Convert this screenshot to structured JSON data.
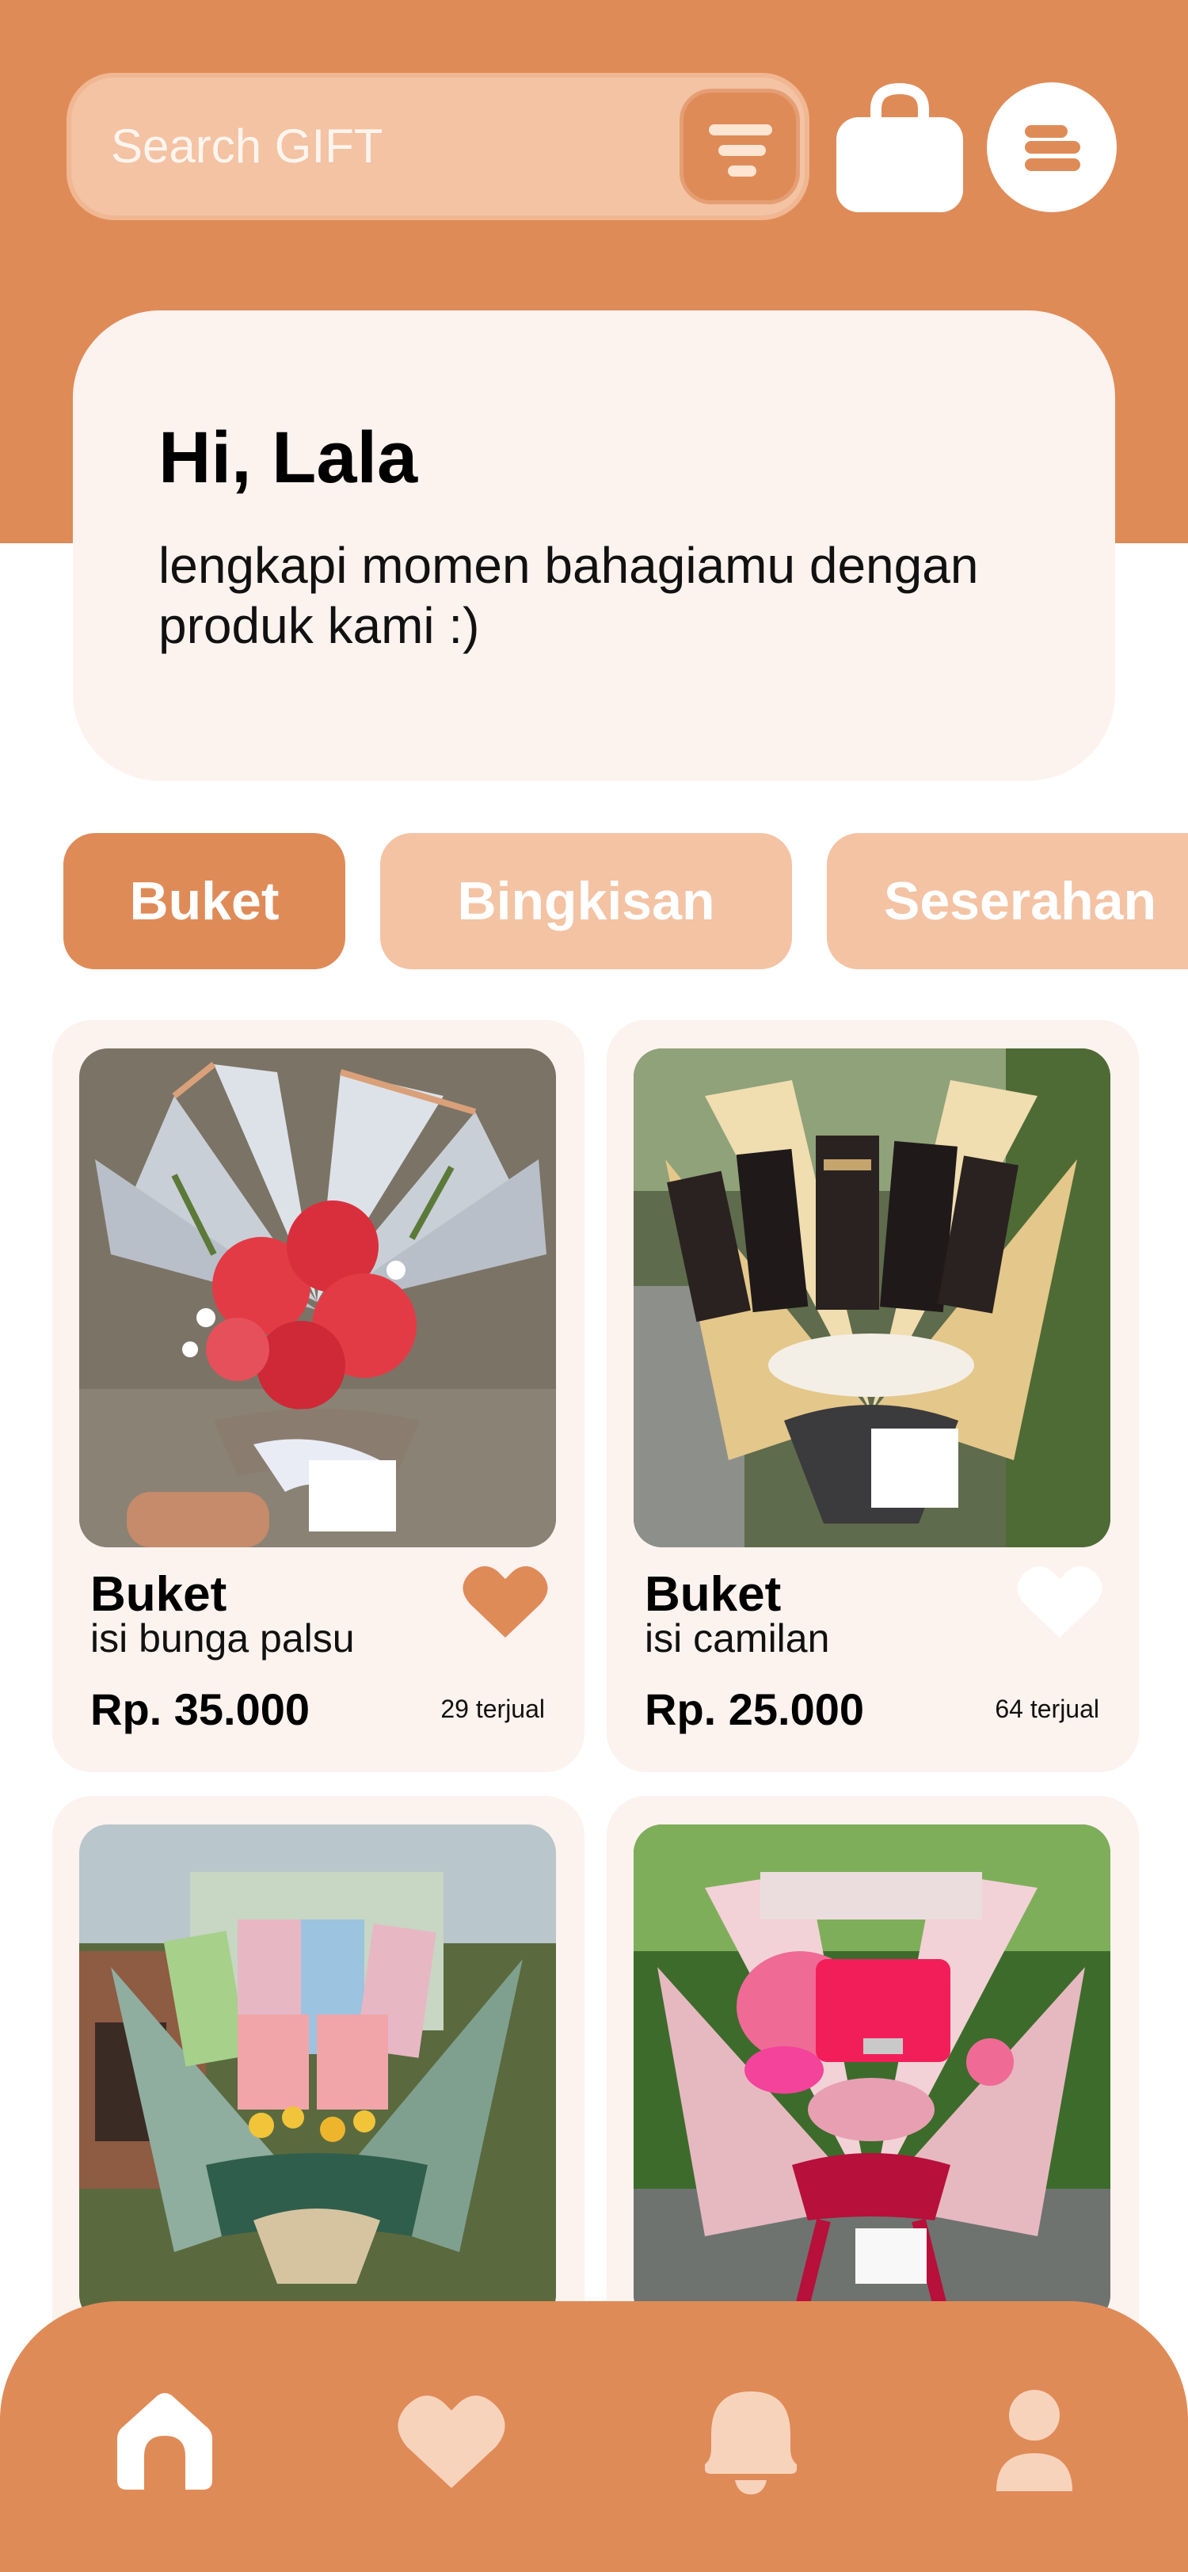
{
  "search": {
    "placeholder": "Search GIFT"
  },
  "greeting": {
    "title": "Hi, Lala",
    "subtitle": "lengkapi momen bahagiamu dengan produk kami :)"
  },
  "categories": [
    {
      "label": "Buket",
      "active": true
    },
    {
      "label": "Bingkisan",
      "active": false
    },
    {
      "label": "Seserahan",
      "active": false
    }
  ],
  "products": [
    {
      "title": "Buket",
      "subtitle": "isi bunga palsu",
      "price": "Rp. 35.000",
      "sold": "29 terjual",
      "favorited": true,
      "image": "red-flower-bouquet"
    },
    {
      "title": "Buket",
      "subtitle": "isi camilan",
      "price": "Rp. 25.000",
      "sold": "64 terjual",
      "favorited": false,
      "image": "snack-bouquet"
    },
    {
      "title": "",
      "subtitle": "",
      "price": "",
      "sold": "",
      "image": "money-bouquet"
    },
    {
      "title": "",
      "subtitle": "",
      "price": "",
      "sold": "",
      "image": "pink-gift-bouquet"
    }
  ],
  "nav": [
    {
      "icon": "home-icon",
      "active": true
    },
    {
      "icon": "heart-icon",
      "active": false
    },
    {
      "icon": "bell-icon",
      "active": false
    },
    {
      "icon": "user-icon",
      "active": false
    }
  ],
  "colors": {
    "primary": "#DF8B58",
    "primary_light": "#F3C3A4",
    "card_bg": "#FCF2EE",
    "nav_icon": "#F8D3BC"
  }
}
